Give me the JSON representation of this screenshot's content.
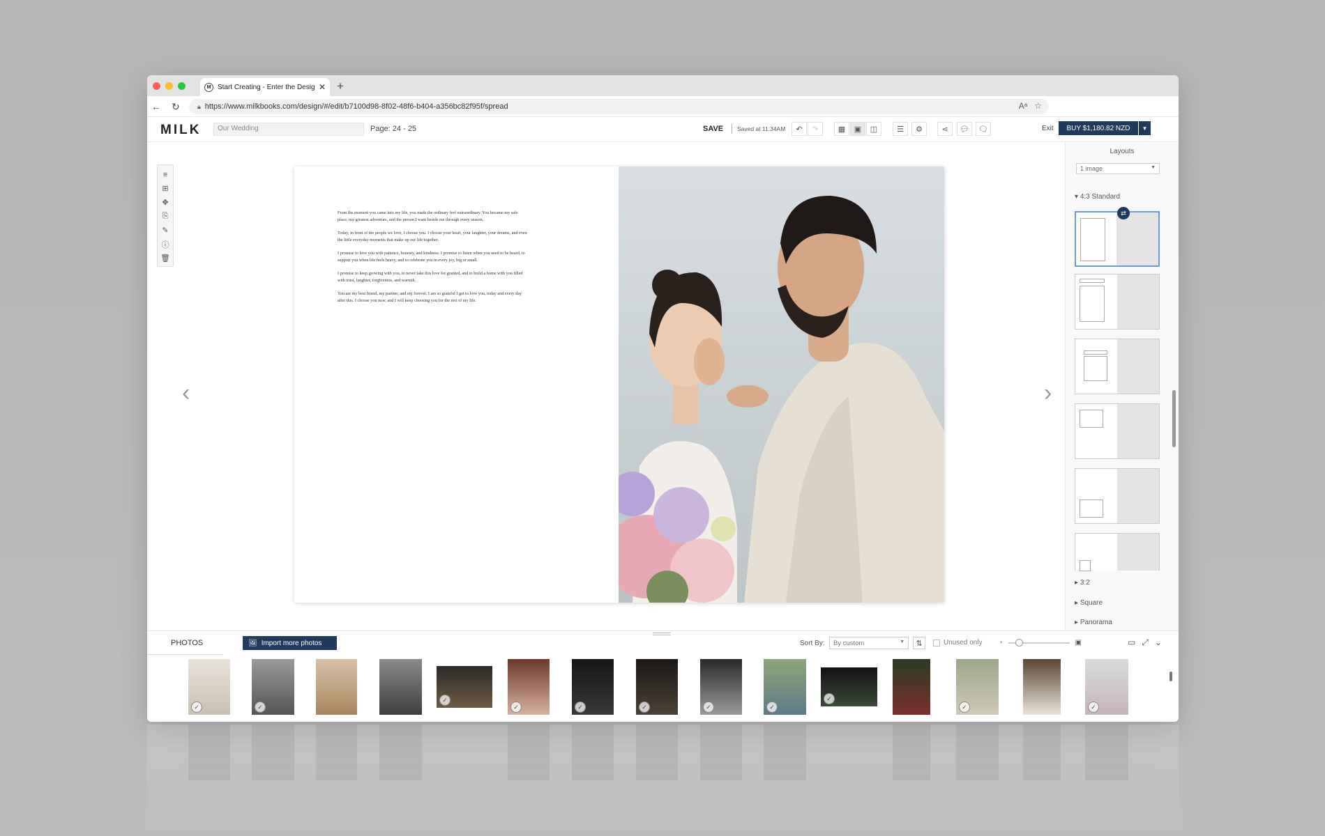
{
  "browser": {
    "tab_title": "Start Creating - Enter the Desig",
    "favicon_letter": "M",
    "url": "https://www.milkbooks.com/design/#/edit/b7100d98-8f02-48f6-b404-a356bc82f95f/spread"
  },
  "toolbar": {
    "logo": "MILK",
    "project_placeholder": "Our Wedding",
    "page_label": "Page: 24 - 25",
    "save_label": "SAVE",
    "saved_status": "Saved at 11:34AM",
    "exit_label": "Exit",
    "buy_label": "BUY $1,180.82 NZD"
  },
  "spread": {
    "vows": [
      "From the moment you came into my life, you made the ordinary feel extraordinary. You became my safe place, my greatest adventure, and the person I want beside me through every season.",
      "Today, in front of the people we love, I choose you. I choose your heart, your laughter, your dreams, and even the little everyday moments that make up our life together.",
      "I promise to love you with patience, honesty, and kindness. I promise to listen when you need to be heard, to support you when life feels heavy, and to celebrate you in every joy, big or small.",
      "I promise to keep growing with you, to never take this love for granted, and to build a home with you filled with trust, laughter, forgiveness, and warmth.",
      "You are my best friend, my partner, and my forever. I am so grateful I get to love you, today and every day after this. I choose you now, and I will keep choosing you for the rest of my life."
    ]
  },
  "layouts_panel": {
    "title": "Layouts",
    "filter_value": "1 image",
    "groups": [
      {
        "label": "4:3 Standard",
        "expanded": true
      },
      {
        "label": "3:2",
        "expanded": false
      },
      {
        "label": "Square",
        "expanded": false
      },
      {
        "label": "Panorama",
        "expanded": false
      }
    ]
  },
  "photos_bar": {
    "tab_label": "PHOTOS",
    "import_label": "Import more photos",
    "sort_label": "Sort By:",
    "sort_value": "By custom",
    "unused_label": "Unused only"
  },
  "colors": {
    "accent": "#1f3a5c",
    "selected_layout_border": "#6d9bd0"
  },
  "icons": {
    "tools": [
      "text-icon",
      "add-image-icon",
      "crop-icon",
      "copy-icon",
      "edit-icon",
      "info-icon",
      "trash-icon"
    ]
  }
}
